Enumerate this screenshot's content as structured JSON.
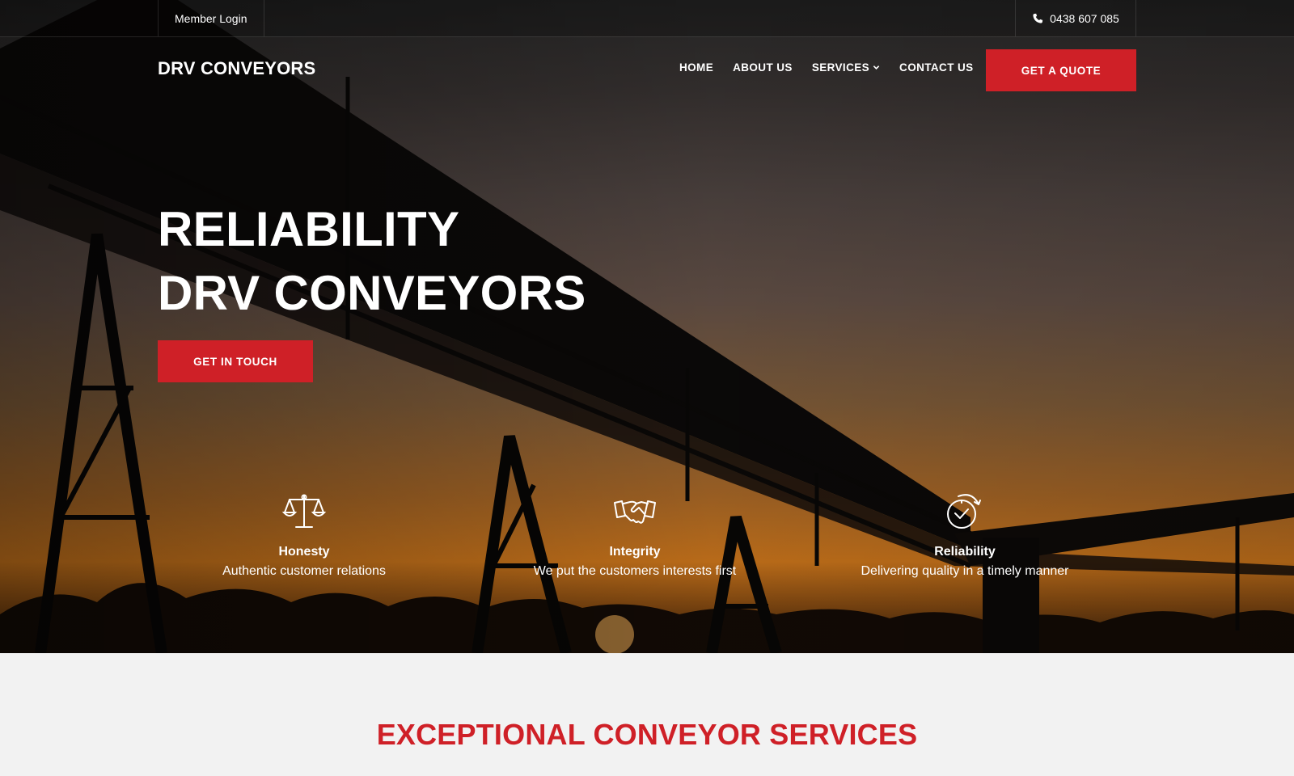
{
  "topbar": {
    "member_login": "Member Login",
    "phone": "0438 607 085"
  },
  "brand": "DRV CONVEYORS",
  "nav": {
    "items": [
      "HOME",
      "ABOUT US",
      "SERVICES",
      "CONTACT US"
    ],
    "quote_button": "GET A QUOTE"
  },
  "hero": {
    "headline_line1": "RELIABILITY",
    "headline_line2": "DRV CONVEYORS",
    "cta_button": "GET IN TOUCH"
  },
  "values": [
    {
      "icon": "scales-icon",
      "title": "Honesty",
      "description": "Authentic customer relations"
    },
    {
      "icon": "handshake-icon",
      "title": "Integrity",
      "description": "We put the customers interests first"
    },
    {
      "icon": "clock-check-icon",
      "title": "Reliability",
      "description": "Delivering quality in a timely manner"
    }
  ],
  "section": {
    "title": "EXCEPTIONAL CONVEYOR SERVICES"
  },
  "colors": {
    "accent": "#cf2027",
    "section_bg": "#f2f2f2"
  }
}
